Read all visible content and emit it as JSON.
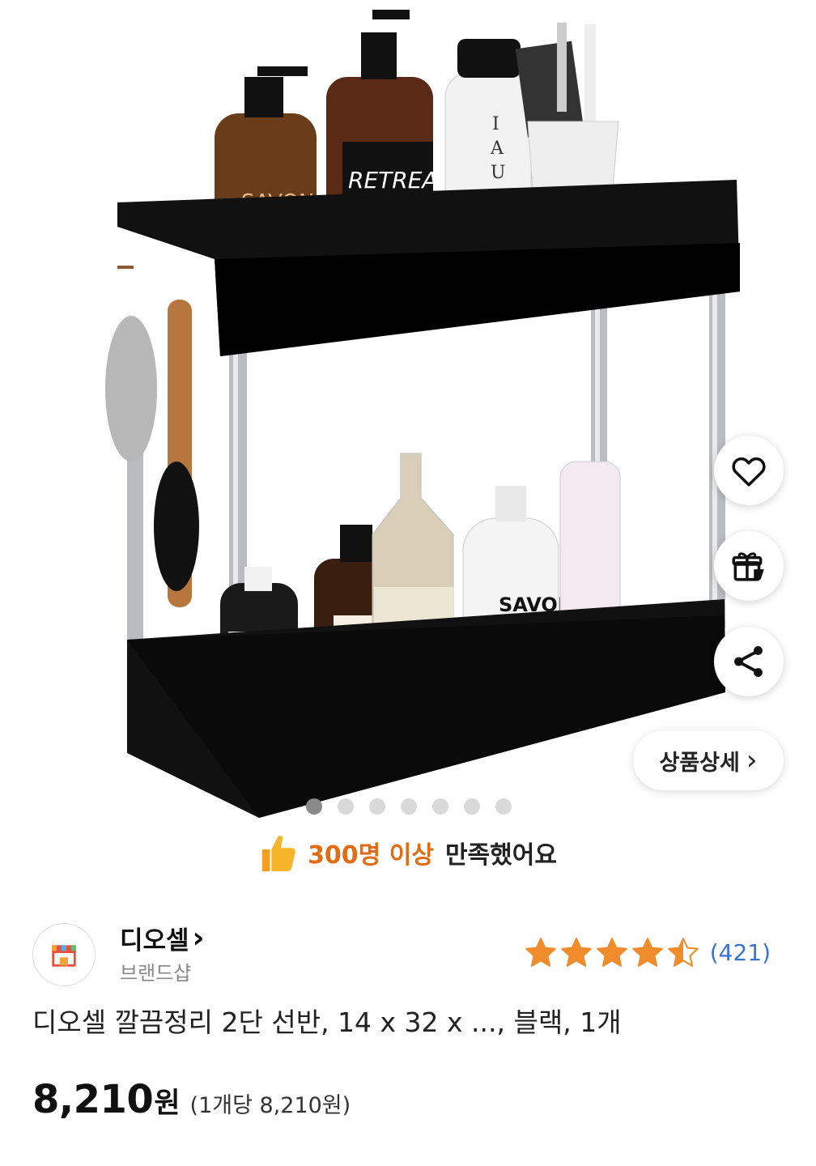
{
  "actions": {
    "detail_label": "상품상세",
    "detail_chevron": "›",
    "like_icon": "heart-icon",
    "gift_icon": "gift-icon",
    "share_icon": "share-icon"
  },
  "gallery": {
    "image_count": 7,
    "current_index": 1
  },
  "satisfaction": {
    "icon": "thumbs-up-icon",
    "highlight": "300명 이상",
    "rest": "만족했어요",
    "accent_color": "#e36b12"
  },
  "seller": {
    "name": "디오셀",
    "chevron": "›",
    "type": "브랜드샵",
    "logo_icon": "store-icon"
  },
  "rating": {
    "value": 4.5,
    "max": 5,
    "review_count": "(421)",
    "star_color": "#f08c2c"
  },
  "product": {
    "title": "디오셀 깔끔정리 2단 선반, 14 x 32 x ..., 블랙, 1개",
    "price": "8,210",
    "currency": "원",
    "unit_price": "(1개당 8,210원)"
  }
}
